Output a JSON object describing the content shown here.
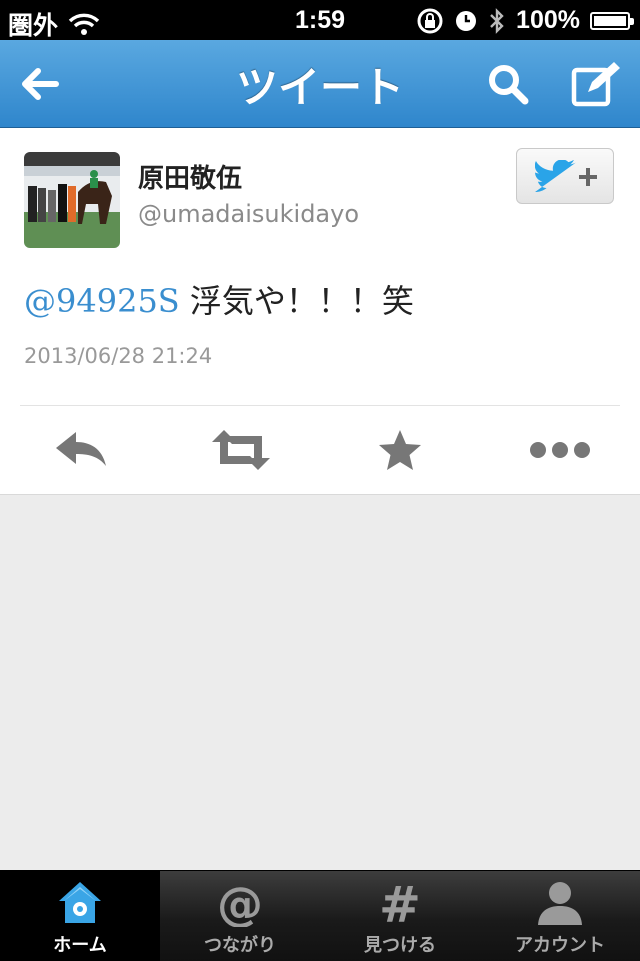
{
  "status_bar": {
    "carrier": "圏外",
    "time": "1:59",
    "battery_label": "100%",
    "battery_level": 1.0
  },
  "nav": {
    "title": "ツイート",
    "back_icon": "back-arrow-icon",
    "search_icon": "search-icon",
    "compose_icon": "compose-icon"
  },
  "tweet": {
    "author_name": "原田敬伍",
    "author_handle": "@umadaisukidayo",
    "mention": "@94925S",
    "text": " 浮気や！！！笑",
    "timestamp": "2013/06/28 21:24"
  },
  "tabs": [
    {
      "label": "ホーム",
      "icon": "home-icon",
      "active": true
    },
    {
      "label": "つながり",
      "icon": "at-sign-icon",
      "active": false
    },
    {
      "label": "見つける",
      "icon": "hashtag-icon",
      "active": false
    },
    {
      "label": "アカウント",
      "icon": "person-icon",
      "active": false
    }
  ],
  "colors": {
    "nav_blue": "#2f86cc",
    "mention_blue": "#3a8ecf",
    "twitter_bird": "#2aa4e8"
  }
}
